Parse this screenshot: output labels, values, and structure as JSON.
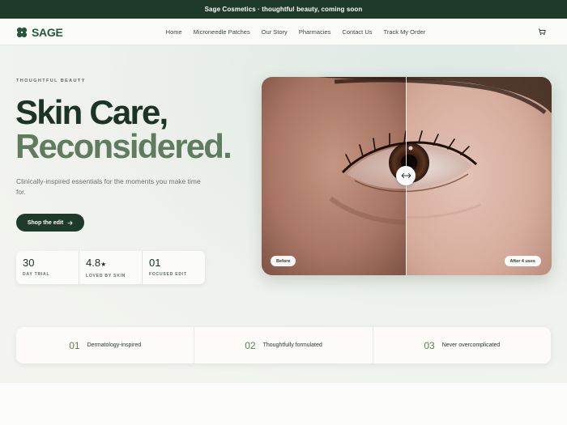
{
  "announcement": "Sage Cosmetics · thoughtful beauty, coming soon",
  "brand": {
    "name": "SAGE",
    "logo_icon": "clover-icon",
    "color": "#23583a"
  },
  "nav": {
    "links": [
      "Home",
      "Microneedle Patches",
      "Our Story",
      "Pharmacies",
      "Contact Us",
      "Track My Order"
    ],
    "cart_icon": "shopping-bag-icon"
  },
  "hero": {
    "eyebrow": "THOUGHTFUL BEAUTY",
    "title_line1": "Skin Care,",
    "title_line2": "Reconsidered.",
    "subtitle": "Clinically-inspired essentials for the moments you make time for.",
    "cta_label": "Shop the edit",
    "cta_icon": "arrow-right-icon"
  },
  "stats": [
    {
      "value": "30",
      "suffix": "",
      "label": "DAY TRIAL"
    },
    {
      "value": "4.8",
      "suffix": "★",
      "label": "LOVED BY SKIN"
    },
    {
      "value": "01",
      "suffix": "",
      "label": "FOCUSED EDIT"
    }
  ],
  "comparison": {
    "before_label": "Before",
    "after_label": "After 4 uses",
    "handle_icon": "double-arrow-icon"
  },
  "features": [
    {
      "num": "01",
      "text": "Dermatology-inspired"
    },
    {
      "num": "02",
      "text": "Thoughtfully formulated"
    },
    {
      "num": "03",
      "text": "Never overcomplicated"
    }
  ],
  "colors": {
    "primary_dark": "#1e3a2a",
    "sage_green": "#5f7d5e",
    "background": "#f7f6f2"
  }
}
